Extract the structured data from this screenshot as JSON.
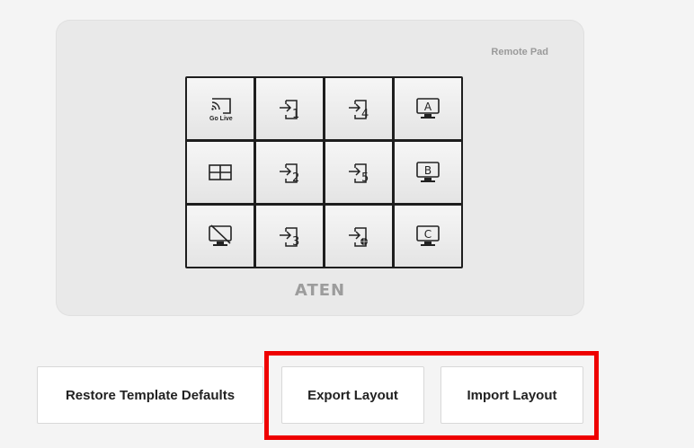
{
  "pad": {
    "label": "Remote Pad",
    "brand": "ATEN",
    "keys": [
      {
        "icon": "go-live-icon",
        "text": "Go Live"
      },
      {
        "icon": "input-icon",
        "text": "1"
      },
      {
        "icon": "input-icon",
        "text": "4"
      },
      {
        "icon": "monitor-icon",
        "text": "A"
      },
      {
        "icon": "layout-quad-icon",
        "text": ""
      },
      {
        "icon": "input-icon",
        "text": "2"
      },
      {
        "icon": "input-icon",
        "text": "5"
      },
      {
        "icon": "monitor-icon",
        "text": "B"
      },
      {
        "icon": "monitor-off-icon",
        "text": ""
      },
      {
        "icon": "input-icon",
        "text": "3"
      },
      {
        "icon": "input-network-icon",
        "text": ""
      },
      {
        "icon": "monitor-icon",
        "text": "C"
      }
    ]
  },
  "buttons": {
    "restore": "Restore Template Defaults",
    "export": "Export Layout",
    "import": "Import Layout"
  },
  "colors": {
    "highlight": "#ee0000"
  }
}
